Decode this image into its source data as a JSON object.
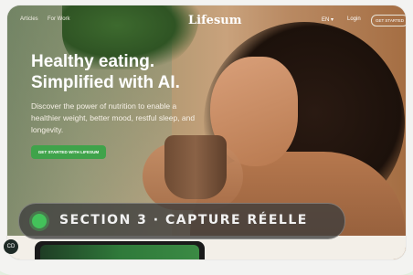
{
  "nav": {
    "links": [
      "Articles",
      "For Work"
    ],
    "logo": "Lifesum",
    "language": "EN",
    "language_caret": "▾",
    "login": "Login",
    "cta": "GET STARTED"
  },
  "hero": {
    "title_line1": "Healthy eating.",
    "title_line2": "Simplified with AI.",
    "subtitle": "Discover the power of nutrition to enable a healthier weight, better mood, restful sleep, and longevity.",
    "button": "GET STARTED WITH LIFESUM"
  },
  "overlay": {
    "section_label": "SECTION 3 · CAPTURE RÉELLE"
  },
  "chat": {
    "label": "CD"
  },
  "colors": {
    "accent_green": "#3fa34a",
    "pill_dot": "#43c25a"
  }
}
